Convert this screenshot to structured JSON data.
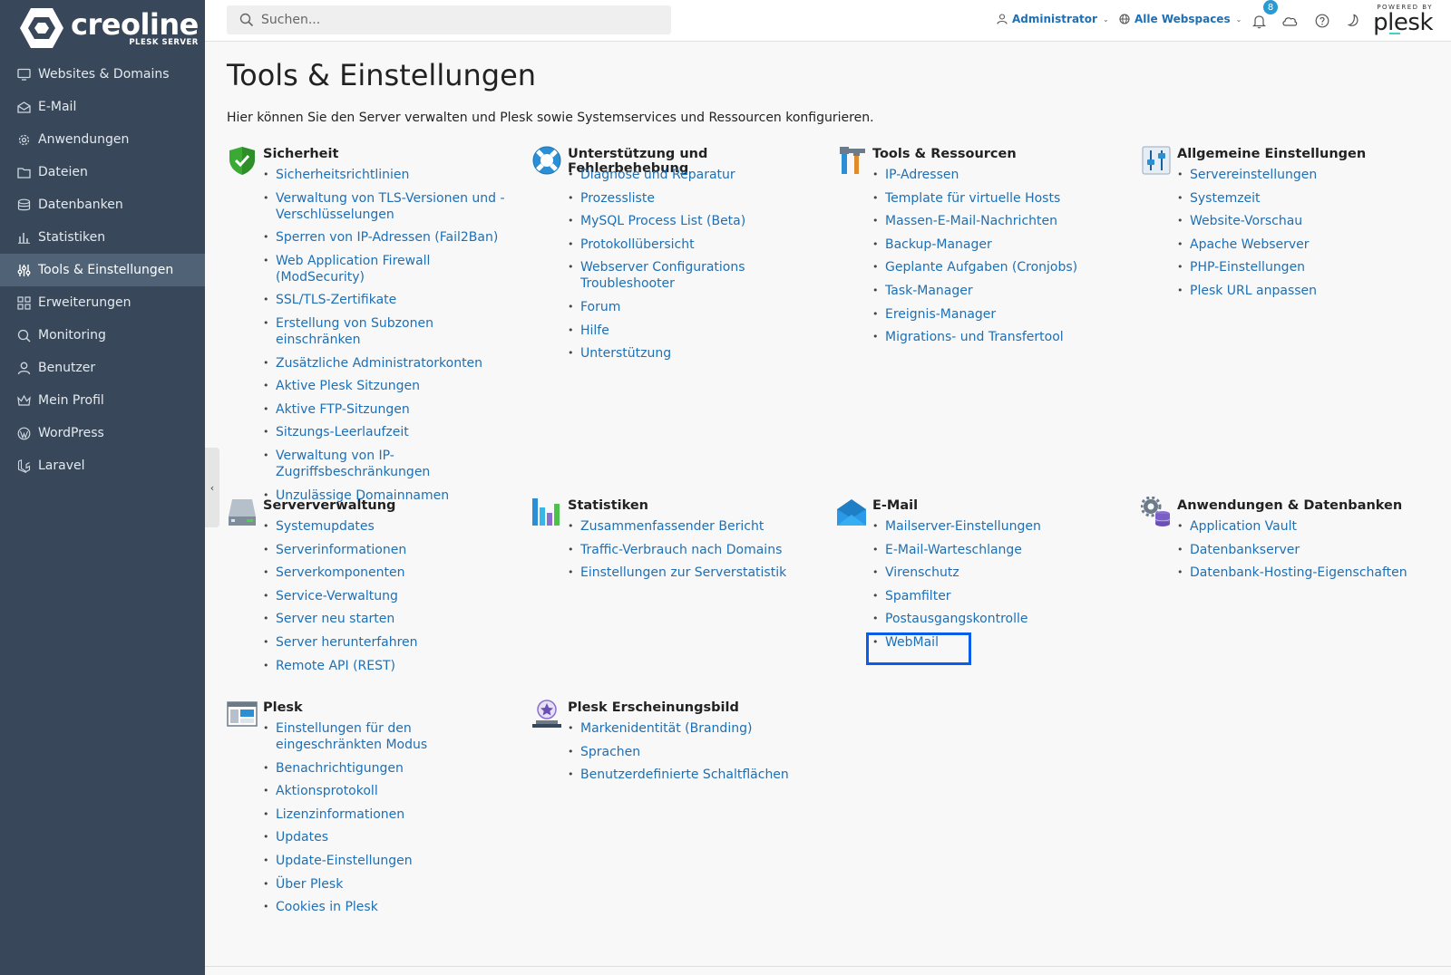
{
  "sidebar": {
    "logo_name": "creoline",
    "logo_sub": "PLESK SERVER",
    "items": [
      {
        "label": "Websites & Domains",
        "icon": "monitor-icon"
      },
      {
        "label": "E-Mail",
        "icon": "envelope-icon"
      },
      {
        "label": "Anwendungen",
        "icon": "gear-icon"
      },
      {
        "label": "Dateien",
        "icon": "folder-icon"
      },
      {
        "label": "Datenbanken",
        "icon": "database-icon"
      },
      {
        "label": "Statistiken",
        "icon": "bar-chart-icon"
      },
      {
        "label": "Tools & Einstellungen",
        "icon": "sliders-icon",
        "active": true
      },
      {
        "label": "Erweiterungen",
        "icon": "grid-icon"
      },
      {
        "label": "Monitoring",
        "icon": "magnifier-icon"
      },
      {
        "label": "Benutzer",
        "icon": "user-icon"
      },
      {
        "label": "Mein Profil",
        "icon": "crown-icon"
      },
      {
        "label": "WordPress",
        "icon": "wordpress-icon"
      },
      {
        "label": "Laravel",
        "icon": "laravel-icon"
      }
    ]
  },
  "header": {
    "search_placeholder": "Suchen...",
    "user_label": "Administrator",
    "webspace_label": "Alle Webspaces",
    "notification_count": "8",
    "powered_by": "POWERED BY",
    "brand": "plesk"
  },
  "main": {
    "title": "Tools & Einstellungen",
    "description": "Hier können Sie den Server verwalten und Plesk sowie Systemservices und Ressourcen konfigurieren.",
    "groups": [
      {
        "title": "Sicherheit",
        "icon": "shield-check-icon",
        "links": [
          "Sicherheitsrichtlinien",
          "Verwaltung von TLS-Versionen und -Verschlüsselungen",
          "Sperren von IP-Adressen (Fail2Ban)",
          "Web Application Firewall (ModSecurity)",
          "SSL/TLS-Zertifikate",
          "Erstellung von Subzonen einschränken",
          "Zusätzliche Administratorkonten",
          "Aktive Plesk Sitzungen",
          "Aktive FTP-Sitzungen",
          "Sitzungs-Leerlaufzeit",
          "Verwaltung von IP-Zugriffsbeschränkungen",
          "Unzulässige Domainnamen"
        ]
      },
      {
        "title": "Unterstützung und Fehlerbehebung",
        "icon": "lifebuoy-icon",
        "links": [
          "Diagnose und Reparatur",
          "Prozessliste",
          "MySQL Process List (Beta)",
          "Protokollübersicht",
          "Webserver Configurations Troubleshooter",
          "Forum",
          "Hilfe",
          "Unterstützung"
        ]
      },
      {
        "title": "Tools & Ressourcen",
        "icon": "tools-icon",
        "links": [
          "IP-Adressen",
          "Template für virtuelle Hosts",
          "Massen-E-Mail-Nachrichten",
          "Backup-Manager",
          "Geplante Aufgaben (Cronjobs)",
          "Task-Manager",
          "Ereignis-Manager",
          "Migrations- und Transfertool"
        ]
      },
      {
        "title": "Allgemeine Einstellungen",
        "icon": "settings-sliders-icon",
        "links": [
          "Servereinstellungen",
          "Systemzeit",
          "Website-Vorschau",
          "Apache Webserver",
          "PHP-Einstellungen",
          "Plesk URL anpassen"
        ]
      },
      {
        "title": "Serververwaltung",
        "icon": "server-icon",
        "links": [
          "Systemupdates",
          "Serverinformationen",
          "Serverkomponenten",
          "Service-Verwaltung",
          "Server neu starten",
          "Server herunterfahren",
          "Remote API (REST)"
        ]
      },
      {
        "title": "Statistiken",
        "icon": "statistics-icon",
        "links": [
          "Zusammenfassender Bericht",
          "Traffic-Verbrauch nach Domains",
          "Einstellungen zur Serverstatistik"
        ]
      },
      {
        "title": "E-Mail",
        "icon": "open-envelope-icon",
        "links": [
          "Mailserver-Einstellungen",
          "E-Mail-Warteschlange",
          "Virenschutz",
          "Spamfilter",
          "Postausgangskontrolle",
          "WebMail"
        ]
      },
      {
        "title": "Anwendungen & Datenbanken",
        "icon": "gears-database-icon",
        "links": [
          "Application Vault",
          "Datenbankserver",
          "Datenbank-Hosting-Eigenschaften"
        ]
      },
      {
        "title": "Plesk",
        "icon": "plesk-window-icon",
        "links": [
          "Einstellungen für den eingeschränkten Modus",
          "Benachrichtigungen",
          "Aktionsprotokoll",
          "Lizenzinformationen",
          "Updates",
          "Update-Einstellungen",
          "Über Plesk",
          "Cookies in Plesk"
        ]
      },
      {
        "title": "Plesk Erscheinungsbild",
        "icon": "branding-icon",
        "links": [
          "Markenidentität (Branding)",
          "Sprachen",
          "Benutzerdefinierte Schaltflächen"
        ]
      }
    ]
  },
  "colors": {
    "sidebar_bg": "#38485a",
    "sidebar_active": "#4f6276",
    "link": "#1e6fb4",
    "highlight": "#0a5de8"
  }
}
